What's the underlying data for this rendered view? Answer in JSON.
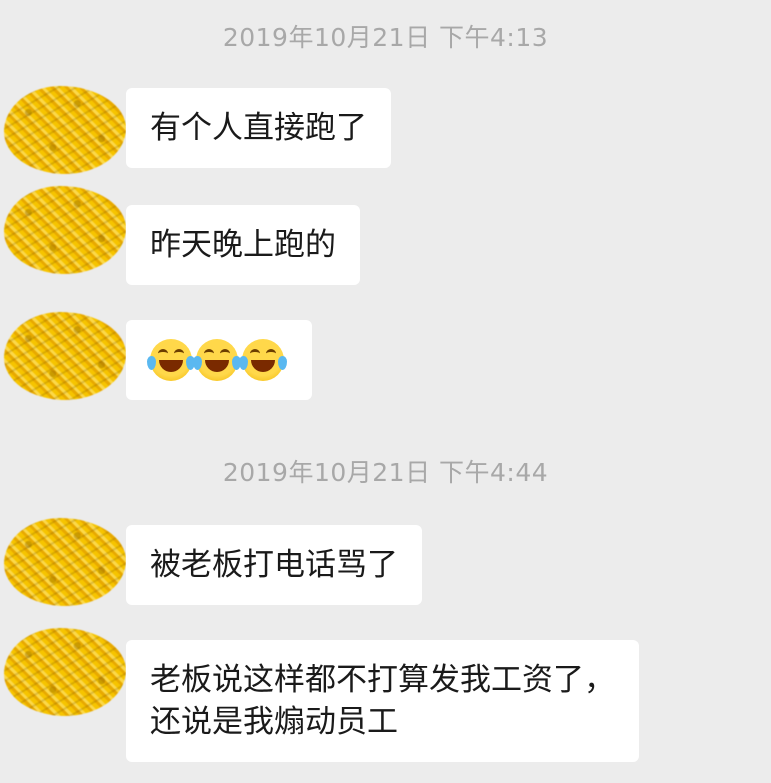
{
  "timestamps": [
    "2019年10月21日 下午4:13",
    "2019年10月21日 下午4:44"
  ],
  "messages": [
    {
      "text": "有个人直接跑了"
    },
    {
      "text": "昨天晚上跑的"
    },
    {
      "emoji": [
        "joy-emoji",
        "joy-emoji",
        "joy-emoji"
      ]
    },
    {
      "text": "被老板打电话骂了"
    },
    {
      "line1": "老板说这样都不打算发我工资了，",
      "line2": "还说是我煽动员工"
    }
  ],
  "colors": {
    "background": "#ececec",
    "bubble": "#ffffff",
    "timestamp": "#a8a8a8",
    "avatar": "#f2bd00"
  }
}
